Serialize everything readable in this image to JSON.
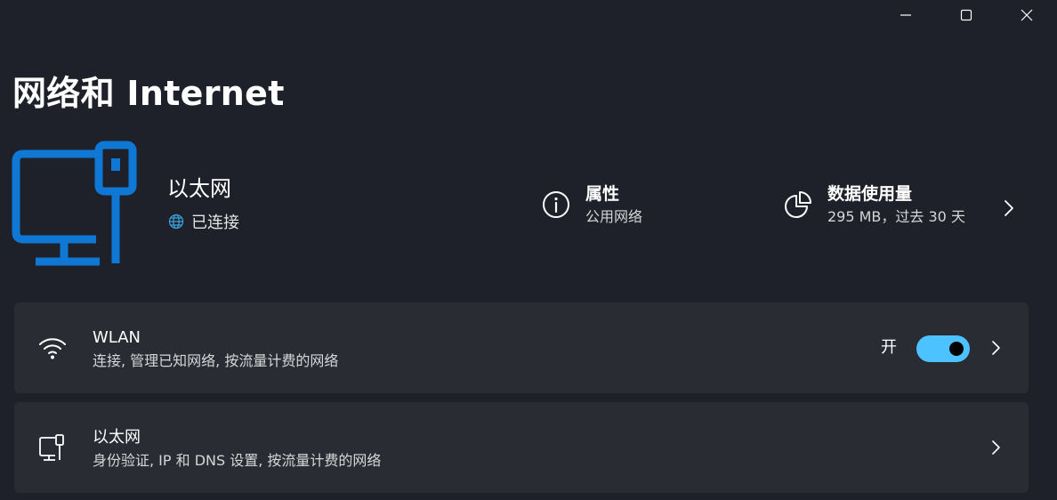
{
  "page": {
    "title": "网络和 Internet"
  },
  "hero": {
    "name": "以太网",
    "status": "已连接",
    "icon": "ethernet-monitor-icon",
    "accent_color": "#0f78d4"
  },
  "summary": {
    "properties": {
      "title": "属性",
      "subtitle": "公用网络",
      "icon": "info-icon"
    },
    "data_usage": {
      "title": "数据使用量",
      "subtitle": "295 MB，过去 30 天",
      "icon": "pie-chart-icon"
    }
  },
  "cards": {
    "wlan": {
      "title": "WLAN",
      "subtitle": "连接, 管理已知网络, 按流量计费的网络",
      "toggle_label": "开",
      "toggle_on": true,
      "toggle_color": "#4cc2ff",
      "icon": "wifi-icon"
    },
    "ethernet": {
      "title": "以太网",
      "subtitle": "身份验证, IP 和 DNS 设置, 按流量计费的网络",
      "icon": "ethernet-icon"
    }
  },
  "window_controls": [
    "minimize-icon",
    "maximize-icon",
    "close-icon"
  ]
}
